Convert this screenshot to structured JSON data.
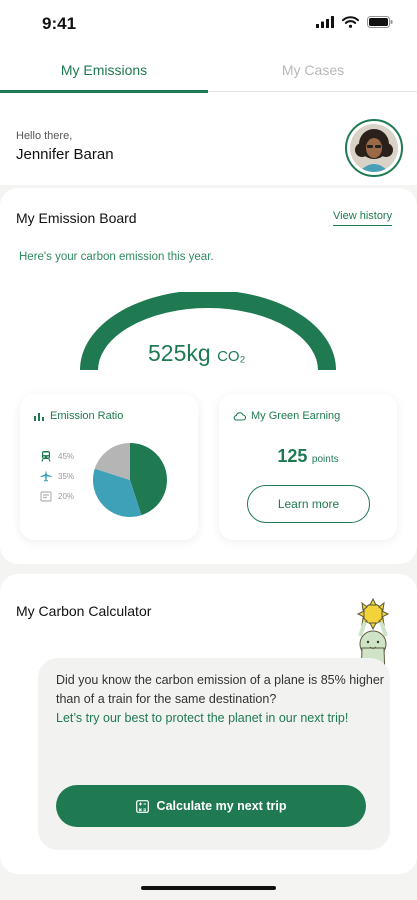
{
  "status_bar": {
    "time": "9:41",
    "icons": [
      "signal-icon",
      "wifi-icon",
      "battery-icon"
    ]
  },
  "tabs": [
    {
      "label": "My Emissions",
      "active": true
    },
    {
      "label": "My Cases",
      "active": false
    }
  ],
  "user": {
    "greeting": "Hello there,",
    "name": "Jennifer Baran"
  },
  "board": {
    "title": "My Emission Board",
    "view_history": "View history",
    "subtitle": "Here's your carbon emission this year.",
    "value": "525kg",
    "unit": "CO₂"
  },
  "ratio": {
    "title": "Emission Ratio",
    "items": [
      {
        "icon": "train-icon",
        "percent": "45%",
        "value": 45,
        "color": "#1f7a52"
      },
      {
        "icon": "plane-icon",
        "percent": "35%",
        "value": 35,
        "color": "#3fa1b8"
      },
      {
        "icon": "other-icon",
        "percent": "20%",
        "value": 20,
        "color": "#b5b5b5"
      }
    ]
  },
  "earning": {
    "title": "My Green Earning",
    "points": "125",
    "points_unit": "points",
    "button": "Learn more"
  },
  "calculator": {
    "title": "My Carbon Calculator",
    "fact": "Did you know the carbon emission of a plane is 85% higher than of a train for the same destination?",
    "cta_text": "Let’s try our best to protect the planet in our next trip!",
    "button": "Calculate my next trip"
  },
  "colors": {
    "brand_green": "#1f7a52",
    "plane_blue": "#3fa1b8",
    "other_gray": "#b5b5b5",
    "background": "#f4f4f2"
  }
}
